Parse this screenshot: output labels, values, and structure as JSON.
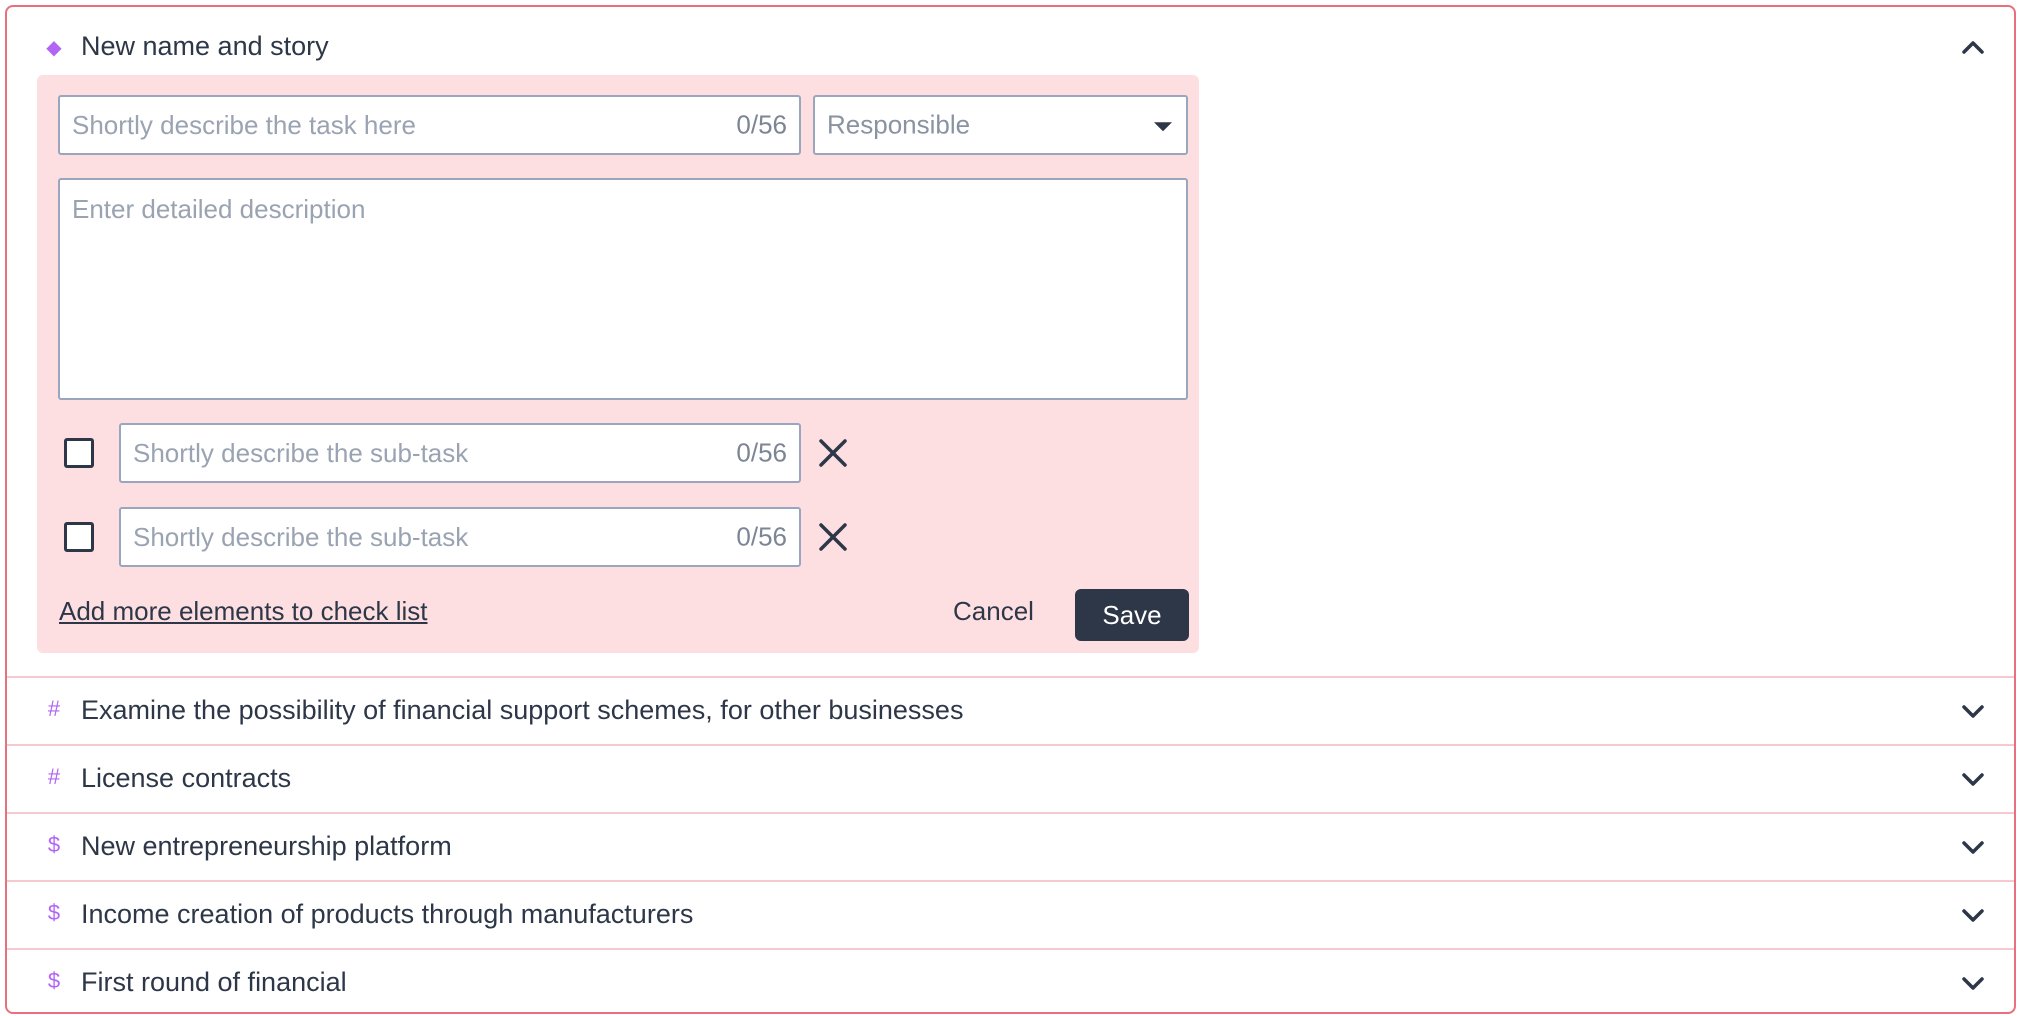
{
  "expanded": {
    "prefix_icon": "diamond-icon",
    "title": "New name and story"
  },
  "form": {
    "task_placeholder": "Shortly describe the task here",
    "task_counter": "0/56",
    "responsible_placeholder": "Responsible",
    "description_placeholder": "Enter detailed description",
    "subtasks": [
      {
        "placeholder": "Shortly describe the sub-task",
        "counter": "0/56",
        "checked": false
      },
      {
        "placeholder": "Shortly describe the sub-task",
        "counter": "0/56",
        "checked": false
      }
    ],
    "add_more_label": "Add more elements to check list",
    "cancel_label": "Cancel",
    "save_label": "Save"
  },
  "items": [
    {
      "prefix": "#",
      "title": "Examine the possibility of financial support schemes, for other businesses"
    },
    {
      "prefix": "#",
      "title": "License contracts"
    },
    {
      "prefix": "$",
      "title": "New entrepreneurship platform"
    },
    {
      "prefix": "$",
      "title": "Income creation of products through manufacturers"
    },
    {
      "prefix": "$",
      "title": "First round of financial"
    }
  ],
  "colors": {
    "accent": "#b264f5",
    "border": "#e8707e",
    "form_background": "#fddfe1",
    "primary_button": "#2d3748"
  }
}
